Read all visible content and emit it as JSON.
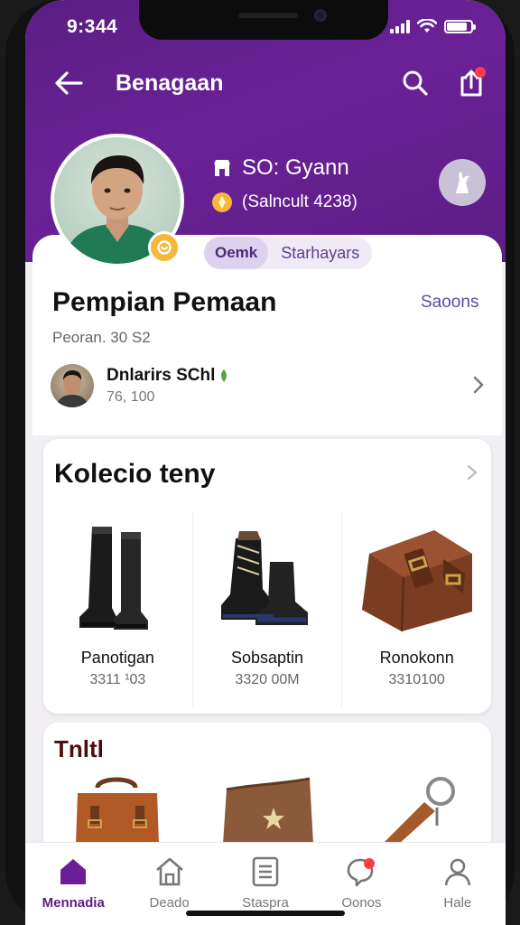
{
  "status": {
    "time": "9:344",
    "battery_level": 0.85
  },
  "header": {
    "title": "Benagaan"
  },
  "profile": {
    "meta_1": "SO: Gyann",
    "meta_2": "(Salncult 4238)",
    "chip_primary": "Oemk",
    "chip_secondary": "Starhayars",
    "name": "Pempian Pemaan",
    "link": "Saoons",
    "sub": "Peoran. 30 S2",
    "follower_name": "Dnlarirs SChl",
    "follower_count": "76, 100"
  },
  "collection": {
    "title": "Kolecio teny",
    "products": [
      {
        "name": "Panotigan",
        "price": "3311 ¹03",
        "icon": "boots-icon"
      },
      {
        "name": "Sobsaptin",
        "price": "3320 00M",
        "icon": "shoes-icon"
      },
      {
        "name": "Ronokonn",
        "price": "3310100",
        "icon": "leather-case-icon"
      }
    ]
  },
  "lower": {
    "title": "Tnltl",
    "items": [
      "bag-icon",
      "pouch-icon",
      "keychain-icon"
    ]
  },
  "tabs": [
    {
      "label": "Mennadia",
      "icon": "home-icon",
      "active": true
    },
    {
      "label": "Deado",
      "icon": "house-icon",
      "active": false
    },
    {
      "label": "Staspra",
      "icon": "list-icon",
      "active": false
    },
    {
      "label": "Oonos",
      "icon": "chat-icon",
      "active": false
    },
    {
      "label": "Hale",
      "icon": "person-icon",
      "active": false
    }
  ],
  "colors": {
    "brand": "#5b1e84",
    "badge": "#f5b83d",
    "notification": "#ff3b47",
    "accent_link": "#5a4aa8"
  }
}
